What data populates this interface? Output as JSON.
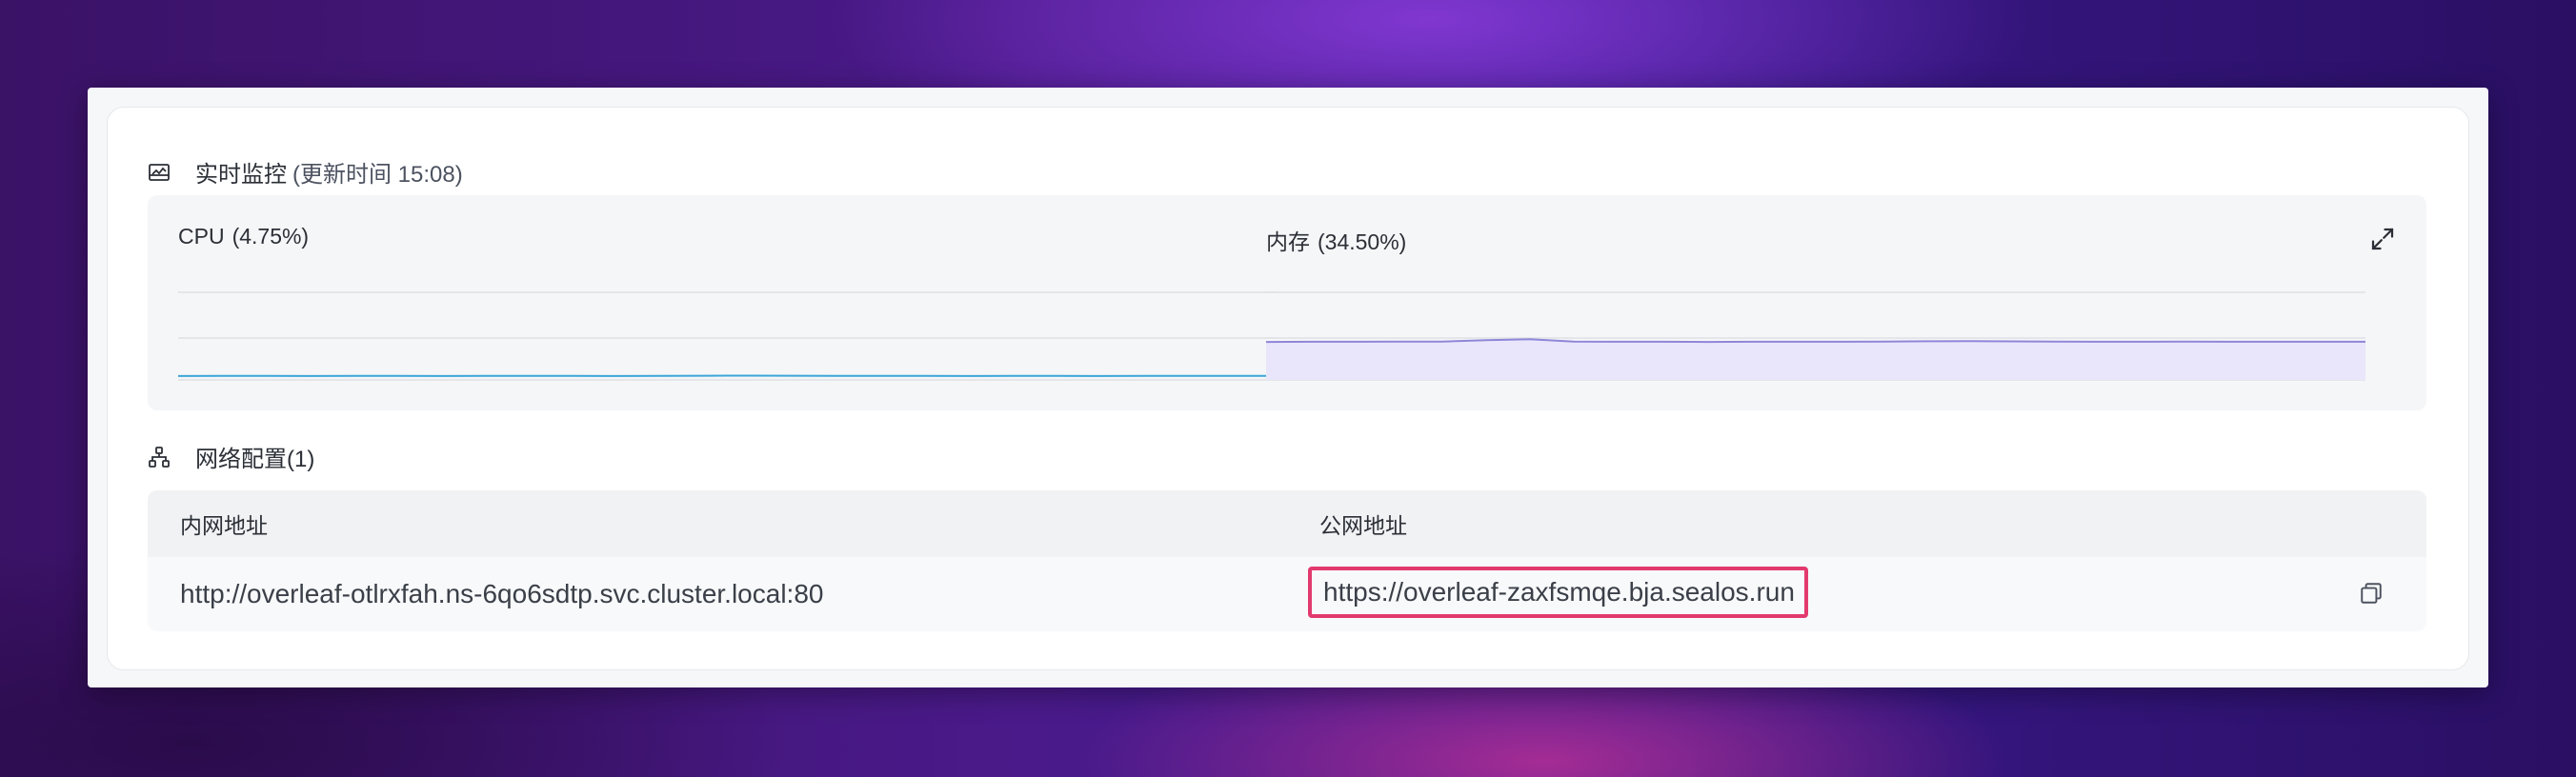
{
  "monitor": {
    "title": "实时监控",
    "updated": "(更新时间 15:08)",
    "icon": "monitor-icon",
    "expand_icon": "expand-icon"
  },
  "charts": {
    "cpu": {
      "label": "CPU",
      "value": "(4.75%)",
      "color": "#3aa6d9"
    },
    "memory": {
      "label": "内存",
      "value": "(34.50%)",
      "color": "#8f86d8",
      "fill": "#e9e6fb"
    }
  },
  "chart_data": [
    {
      "type": "line",
      "title": "CPU (4.75%)",
      "series": [
        {
          "name": "CPU",
          "values": [
            4.6,
            4.7,
            4.7,
            4.6,
            4.7,
            4.7,
            4.6,
            4.7,
            4.7,
            4.7,
            4.6,
            4.7,
            4.9,
            5.0,
            4.9,
            4.8,
            4.7,
            4.7,
            4.6,
            4.7,
            4.7,
            4.6,
            4.7,
            4.7,
            4.7,
            4.75
          ]
        }
      ],
      "ylim": [
        0,
        100
      ],
      "grid": true
    },
    {
      "type": "area",
      "title": "内存 (34.50%)",
      "series": [
        {
          "name": "内存",
          "values": [
            34.4,
            34.5,
            34.5,
            34.6,
            34.6,
            35.4,
            36.0,
            34.6,
            34.5,
            34.5,
            34.4,
            34.5,
            34.5,
            34.5,
            34.6,
            34.8,
            34.9,
            34.7,
            34.6,
            34.5,
            34.5,
            34.6,
            34.5,
            34.5,
            34.5,
            34.5
          ]
        }
      ],
      "ylim": [
        0,
        100
      ],
      "grid": true
    }
  ],
  "network": {
    "title": "网络配置(1)",
    "icon": "network-icon",
    "headers": {
      "internal": "内网地址",
      "public": "公网地址"
    },
    "rows": [
      {
        "internal": "http://overleaf-otlrxfah.ns-6qo6sdtp.svc.cluster.local:80",
        "public": "https://overleaf-zaxfsmqe.bja.sealos.run"
      }
    ],
    "highlight_color": "#e23a6e",
    "copy_icon": "copy-icon"
  }
}
